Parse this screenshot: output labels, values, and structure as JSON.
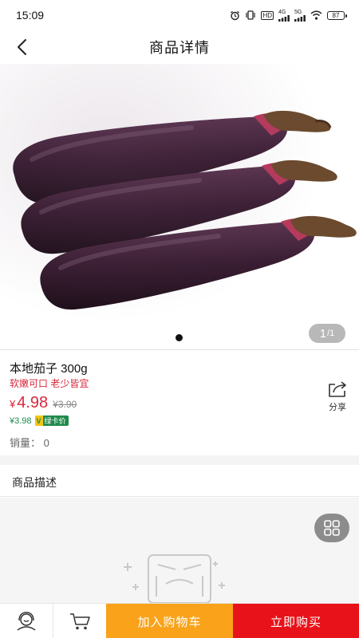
{
  "status_bar": {
    "time": "15:09",
    "network_4g": "4G",
    "network_5g": "5G",
    "hd_label": "HD",
    "battery": "87"
  },
  "nav": {
    "title": "商品详情"
  },
  "gallery": {
    "current": "1",
    "total": "/1",
    "dot_count": 1
  },
  "product": {
    "name": "本地茄子 300g",
    "subtitle": "软嫩可口 老少皆宜",
    "currency": "¥",
    "price": "4.98",
    "original_price": "¥3.90",
    "member_price": "¥3.98",
    "member_badge_v": "V",
    "member_badge_label": "绿卡价",
    "sales": "销量：  0"
  },
  "share": {
    "label": "分享"
  },
  "description": {
    "title": "商品描述"
  },
  "bottom": {
    "add_cart": "加入购物车",
    "buy_now": "立即购买"
  },
  "colors": {
    "price_red": "#d8283a",
    "member_green": "#1f8a4c",
    "add_cart_orange": "#f9a21a",
    "buy_red": "#e8131a"
  }
}
